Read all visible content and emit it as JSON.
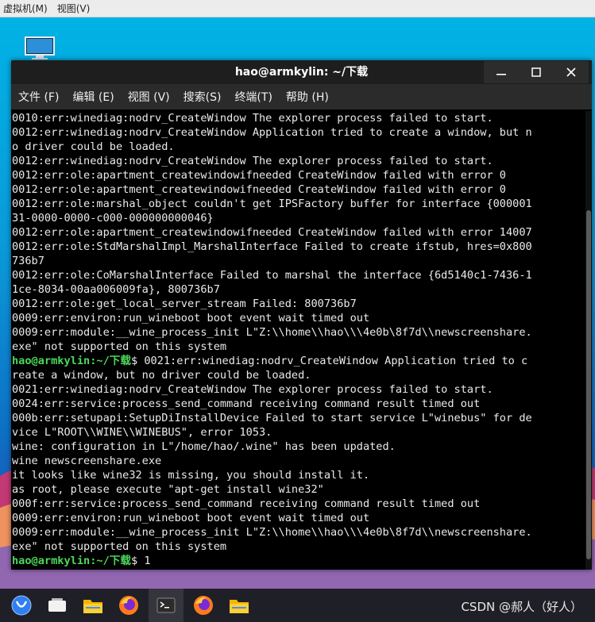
{
  "vm_menu": [
    "虚拟机(M)",
    "视图(V)"
  ],
  "window": {
    "title": "hao@armkylin: ~/下载",
    "menu": [
      "文件 (F)",
      "编辑 (E)",
      "视图 (V)",
      "搜索(S)",
      "终端(T)",
      "帮助 (H)"
    ]
  },
  "terminal": {
    "prompt": "hao@armkylin:~/下载",
    "lines": [
      {
        "t": "0010:err:winediag:nodrv_CreateWindow The explorer process failed to start."
      },
      {
        "t": "0012:err:winediag:nodrv_CreateWindow Application tried to create a window, but n"
      },
      {
        "t": "o driver could be loaded."
      },
      {
        "t": "0012:err:winediag:nodrv_CreateWindow The explorer process failed to start."
      },
      {
        "t": "0012:err:ole:apartment_createwindowifneeded CreateWindow failed with error 0"
      },
      {
        "t": "0012:err:ole:apartment_createwindowifneeded CreateWindow failed with error 0"
      },
      {
        "t": "0012:err:ole:marshal_object couldn't get IPSFactory buffer for interface {000001"
      },
      {
        "t": "31-0000-0000-c000-000000000046}"
      },
      {
        "t": "0012:err:ole:apartment_createwindowifneeded CreateWindow failed with error 14007"
      },
      {
        "t": "0012:err:ole:StdMarshalImpl_MarshalInterface Failed to create ifstub, hres=0x800"
      },
      {
        "t": "736b7"
      },
      {
        "t": "0012:err:ole:CoMarshalInterface Failed to marshal the interface {6d5140c1-7436-1"
      },
      {
        "t": "1ce-8034-00aa006009fa}, 800736b7"
      },
      {
        "t": "0012:err:ole:get_local_server_stream Failed: 800736b7"
      },
      {
        "t": "0009:err:environ:run_wineboot boot event wait timed out"
      },
      {
        "t": "0009:err:module:__wine_process_init L\"Z:\\\\home\\\\hao\\\\\\4e0b\\8f7d\\\\newscreenshare."
      },
      {
        "t": "exe\" not supported on this system"
      },
      {
        "p": true,
        "t": "$ 0021:err:winediag:nodrv_CreateWindow Application tried to c"
      },
      {
        "t": "reate a window, but no driver could be loaded."
      },
      {
        "t": "0021:err:winediag:nodrv_CreateWindow The explorer process failed to start."
      },
      {
        "t": "0024:err:service:process_send_command receiving command result timed out"
      },
      {
        "t": "000b:err:setupapi:SetupDiInstallDevice Failed to start service L\"winebus\" for de"
      },
      {
        "t": "vice L\"ROOT\\\\WINE\\\\WINEBUS\", error 1053."
      },
      {
        "t": "wine: configuration in L\"/home/hao/.wine\" has been updated."
      },
      {
        "t": "wine newscreenshare.exe"
      },
      {
        "t": "it looks like wine32 is missing, you should install it."
      },
      {
        "t": "as root, please execute \"apt-get install wine32\""
      },
      {
        "t": "000f:err:service:process_send_command receiving command result timed out"
      },
      {
        "t": "0009:err:environ:run_wineboot boot event wait timed out"
      },
      {
        "t": "0009:err:module:__wine_process_init L\"Z:\\\\home\\\\hao\\\\\\4e0b\\8f7d\\\\newscreenshare."
      },
      {
        "t": "exe\" not supported on this system"
      },
      {
        "p": true,
        "t": "$ 1"
      }
    ]
  },
  "taskbar": {
    "icons": [
      "kylin-start-icon",
      "multitask-view-icon",
      "file-manager-icon",
      "firefox-icon",
      "terminal-icon",
      "firefox-icon",
      "file-manager-icon"
    ]
  },
  "watermark": "CSDN @郝人（好人）",
  "colors": {
    "prompt": "#4cd85a",
    "terminal_bg": "#000000",
    "taskbar": "#1f1f27"
  }
}
